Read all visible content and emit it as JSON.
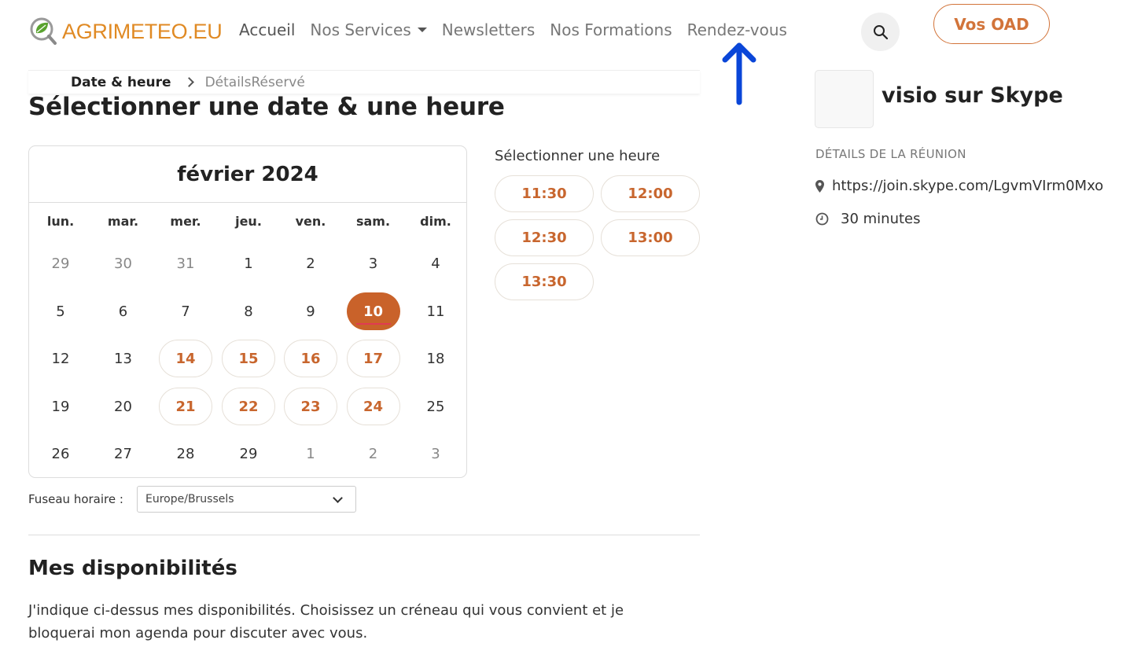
{
  "brand": {
    "name": "AGRIMETEO.EU",
    "accent": "#e08a24",
    "leaf": "#5aa32f"
  },
  "nav": {
    "items": [
      "Accueil",
      "Nos Services",
      "Newsletters",
      "Nos Formations",
      "Rendez-vous"
    ],
    "search_icon": "search-icon",
    "cta_label": "Vos OAD"
  },
  "breadcrumb": {
    "active": "Date & heure",
    "rest": "DétailsRéservé"
  },
  "page": {
    "title": "Sélectionner une date & une heure"
  },
  "calendar": {
    "month_label": "février 2024",
    "weekdays": [
      "lun.",
      "mar.",
      "mer.",
      "jeu.",
      "ven.",
      "sam.",
      "dim."
    ],
    "weeks": [
      [
        {
          "d": "29",
          "s": "muted"
        },
        {
          "d": "30",
          "s": "muted"
        },
        {
          "d": "31",
          "s": "muted"
        },
        {
          "d": "1",
          "s": ""
        },
        {
          "d": "2",
          "s": ""
        },
        {
          "d": "3",
          "s": ""
        },
        {
          "d": "4",
          "s": ""
        }
      ],
      [
        {
          "d": "5",
          "s": ""
        },
        {
          "d": "6",
          "s": ""
        },
        {
          "d": "7",
          "s": ""
        },
        {
          "d": "8",
          "s": ""
        },
        {
          "d": "9",
          "s": ""
        },
        {
          "d": "10",
          "s": "selected"
        },
        {
          "d": "11",
          "s": ""
        }
      ],
      [
        {
          "d": "12",
          "s": ""
        },
        {
          "d": "13",
          "s": ""
        },
        {
          "d": "14",
          "s": "avail"
        },
        {
          "d": "15",
          "s": "avail"
        },
        {
          "d": "16",
          "s": "avail"
        },
        {
          "d": "17",
          "s": "avail"
        },
        {
          "d": "18",
          "s": ""
        }
      ],
      [
        {
          "d": "19",
          "s": ""
        },
        {
          "d": "20",
          "s": ""
        },
        {
          "d": "21",
          "s": "avail"
        },
        {
          "d": "22",
          "s": "avail"
        },
        {
          "d": "23",
          "s": "avail"
        },
        {
          "d": "24",
          "s": "avail"
        },
        {
          "d": "25",
          "s": ""
        }
      ],
      [
        {
          "d": "26",
          "s": ""
        },
        {
          "d": "27",
          "s": ""
        },
        {
          "d": "28",
          "s": ""
        },
        {
          "d": "29",
          "s": ""
        },
        {
          "d": "1",
          "s": "muted"
        },
        {
          "d": "2",
          "s": "muted"
        },
        {
          "d": "3",
          "s": "muted"
        }
      ]
    ],
    "selected_color": "#c9622a",
    "available_color": "#c8662e"
  },
  "times": {
    "label": "Sélectionner une heure",
    "slots": [
      "11:30",
      "12:00",
      "12:30",
      "13:00",
      "13:30"
    ]
  },
  "timezone": {
    "label": "Fuseau horaire :",
    "value": "Europe/Brussels"
  },
  "availability": {
    "title": "Mes disponibilités",
    "text": "J'indique ci-dessus mes disponibilités. Choisissez un créneau qui vous convient et je bloquerai mon agenda pour discuter avec vous."
  },
  "meeting": {
    "title": "visio sur Skype",
    "details_heading": "DÉTAILS DE LA RÉUNION",
    "link": "https://join.skype.com/LgvmVIrm0Mxo",
    "duration": "30 minutes"
  },
  "annotation": {
    "arrow_color": "#0a46d8"
  }
}
